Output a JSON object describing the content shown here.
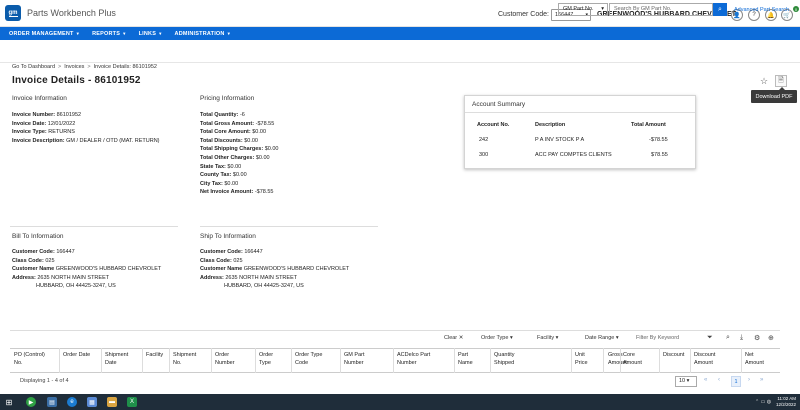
{
  "app": {
    "logo_text": "gm",
    "title": "Parts Workbench Plus"
  },
  "header": {
    "customer_code_label": "Customer Code:",
    "customer_code_value": "166447",
    "dealer_name": "GREENWOOD'S HUBBARD CHEVROLET",
    "cart_count": "0"
  },
  "nav": {
    "items": [
      {
        "label": "ORDER MANAGEMENT"
      },
      {
        "label": "REPORTS"
      },
      {
        "label": "LINKS"
      },
      {
        "label": "ADMINISTRATION"
      }
    ]
  },
  "search": {
    "type_value": "GM Part No.",
    "placeholder": "Search By GM Part No.",
    "advanced_link": "Advanced Part Search"
  },
  "breadcrumb": [
    "Go To Dashboard",
    "Invoices",
    "Invoice Details: 86101952"
  ],
  "page": {
    "title": "Invoice Details - 86101952",
    "tooltip": "Download PDF"
  },
  "invoice_info": {
    "title": "Invoice Information",
    "rows": [
      {
        "label": "Invoice Number:",
        "value": "86101952"
      },
      {
        "label": "Invoice Date:",
        "value": "12/01/2022"
      },
      {
        "label": "Invoice Type:",
        "value": "RETURNS"
      },
      {
        "label": "Invoice Description:",
        "value": "GM / DEALER / OTD (MAT. RETURN)"
      }
    ]
  },
  "pricing_info": {
    "title": "Pricing Information",
    "rows": [
      {
        "label": "Total Quantity:",
        "value": "-6"
      },
      {
        "label": "Total Gross Amount:",
        "value": "-$78.55"
      },
      {
        "label": "Total Core Amount:",
        "value": "$0.00"
      },
      {
        "label": "Total Discounts:",
        "value": "$0.00"
      },
      {
        "label": "Total Shipping Charges:",
        "value": "$0.00"
      },
      {
        "label": "Total Other Charges:",
        "value": "$0.00"
      },
      {
        "label": "State Tax:",
        "value": "$0.00"
      },
      {
        "label": "County Tax:",
        "value": "$0.00"
      },
      {
        "label": "City Tax:",
        "value": "$0.00"
      },
      {
        "label": "Net Invoice Amount:",
        "value": "-$78.55"
      }
    ]
  },
  "account_summary": {
    "title": "Account Summary",
    "headers": [
      "Account No.",
      "Description",
      "Total Amount"
    ],
    "rows": [
      {
        "account": "242",
        "description": "P A INV STOCK P A",
        "amount": "-$78.55"
      },
      {
        "account": "300",
        "description": "ACC PAY COMPTES CLIENTS",
        "amount": "$78.55"
      }
    ]
  },
  "bill_to": {
    "title": "Bill To Information",
    "customer_code_label": "Customer Code:",
    "customer_code": "166447",
    "class_code_label": "Class Code:",
    "class_code": "025",
    "customer_name_label": "Customer Name",
    "customer_name": "GREENWOOD'S HUBBARD CHEVROLET",
    "address_label": "Address:",
    "address_1": "2635 NORTH MAIN STREET",
    "address_2": "HUBBARD, OH 44425-3247, US"
  },
  "ship_to": {
    "title": "Ship To Information",
    "customer_code_label": "Customer Code:",
    "customer_code": "166447",
    "class_code_label": "Class Code:",
    "class_code": "025",
    "customer_name_label": "Customer Name",
    "customer_name": "GREENWOOD'S HUBBARD CHEVROLET",
    "address_label": "Address:",
    "address_1": "2635 NORTH MAIN STREET",
    "address_2": "HUBBARD, OH 44425-3247, US"
  },
  "grid": {
    "toolbar": {
      "clear": "Clear",
      "order_type": "Order Type",
      "facility": "Facility",
      "date_range": "Date Range",
      "filter_placeholder": "Filter By Keyword"
    },
    "columns": [
      {
        "l1": "PO (Control)",
        "l2": "No."
      },
      {
        "l1": "Order Date",
        "l2": ""
      },
      {
        "l1": "Shipment",
        "l2": "Date"
      },
      {
        "l1": "Facility",
        "l2": ""
      },
      {
        "l1": "Shipment",
        "l2": "No."
      },
      {
        "l1": "Order",
        "l2": "Number"
      },
      {
        "l1": "Order",
        "l2": "Type"
      },
      {
        "l1": "Order Type",
        "l2": "Code"
      },
      {
        "l1": "GM Part",
        "l2": "Number"
      },
      {
        "l1": "ACDelco Part",
        "l2": "Number"
      },
      {
        "l1": "Part",
        "l2": "Name"
      },
      {
        "l1": "Quantity",
        "l2": "Shipped"
      },
      {
        "l1": "Unit",
        "l2": "Price"
      },
      {
        "l1": "Gross",
        "l2": "Amount"
      },
      {
        "l1": "Core",
        "l2": "Amount"
      },
      {
        "l1": "Discount",
        "l2": ""
      },
      {
        "l1": "Discount",
        "l2": "Amount"
      },
      {
        "l1": "Net",
        "l2": "Amount"
      }
    ],
    "displaying": "Displaying 1 - 4 of 4",
    "page_size": "10",
    "current_page": "1"
  },
  "taskbar": {
    "time": "11:02 AM",
    "date": "12/2/2022"
  }
}
